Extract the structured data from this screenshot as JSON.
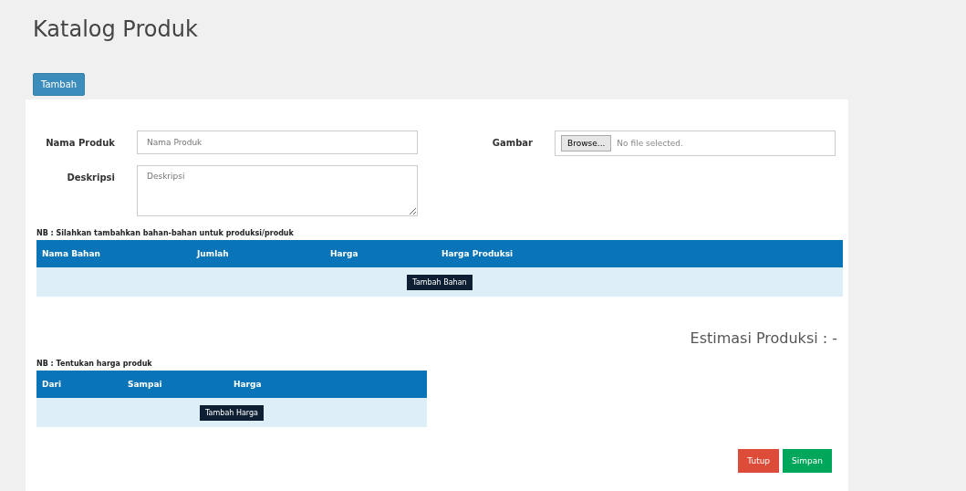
{
  "title": "Katalog Produk",
  "add_button": "Tambah",
  "form": {
    "name_label": "Nama Produk",
    "name_placeholder": "Nama Produk",
    "desc_label": "Deskripsi",
    "desc_placeholder": "Deskripsi",
    "image_label": "Gambar",
    "browse_button": "Browse...",
    "file_status": "No file selected."
  },
  "materials": {
    "note": "NB : Silahkan tambahkan bahan-bahan untuk produksi/produk",
    "columns": [
      "Nama Bahan",
      "Jumlah",
      "Harga",
      "Harga Produksi"
    ],
    "add_button": "Tambah Bahan"
  },
  "estimate": "Estimasi Produksi : -",
  "prices": {
    "note": "NB : Tentukan harga produk",
    "columns": [
      "Dari",
      "Sampai",
      "Harga"
    ],
    "add_button": "Tambah Harga"
  },
  "footer_buttons": [
    {
      "label": "Tutup",
      "kind": "danger"
    },
    {
      "label": "Simpan",
      "kind": "success"
    }
  ]
}
